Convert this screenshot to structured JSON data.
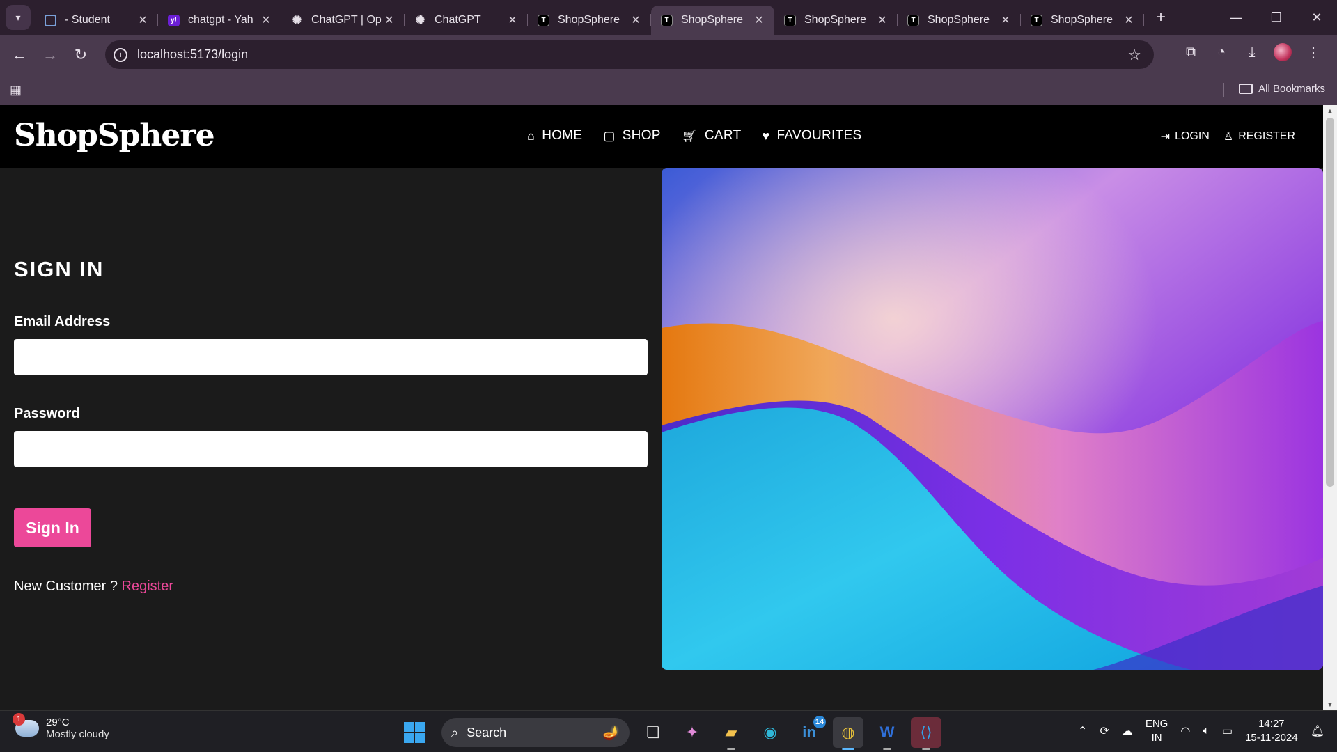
{
  "browser": {
    "tabs": [
      {
        "title": "- Student",
        "favicon": "doc-icon"
      },
      {
        "title": "chatgpt - Yah",
        "favicon": "yahoo-icon"
      },
      {
        "title": "ChatGPT | Op",
        "favicon": "openai-icon"
      },
      {
        "title": "ChatGPT",
        "favicon": "openai-icon"
      },
      {
        "title": "ShopSphere",
        "favicon": "t-icon"
      },
      {
        "title": "ShopSphere",
        "favicon": "t-icon",
        "active": true
      },
      {
        "title": "ShopSphere",
        "favicon": "t-icon"
      },
      {
        "title": "ShopSphere",
        "favicon": "t-icon"
      },
      {
        "title": "ShopSphere",
        "favicon": "t-icon"
      }
    ],
    "url": "localhost:5173/login",
    "all_bookmarks": "All Bookmarks"
  },
  "site": {
    "logo": "ShopSphere",
    "nav": [
      {
        "label": "HOME",
        "icon": "home-icon"
      },
      {
        "label": "SHOP",
        "icon": "shopping-bag-icon"
      },
      {
        "label": "CART",
        "icon": "cart-icon"
      },
      {
        "label": "FAVOURITES",
        "icon": "heart-icon"
      }
    ],
    "auth": [
      {
        "label": "LOGIN",
        "icon": "login-icon"
      },
      {
        "label": "REGISTER",
        "icon": "user-icon"
      }
    ]
  },
  "form": {
    "title": "SIGN IN",
    "email_label": "Email Address",
    "email_value": "",
    "password_label": "Password",
    "password_value": "",
    "submit_label": "Sign In",
    "new_customer_text": "New Customer ?",
    "register_link": "Register"
  },
  "taskbar": {
    "weather_temp": "29°C",
    "weather_cond": "Mostly cloudy",
    "weather_badge": "1",
    "search_label": "Search",
    "linkedin_badge": "14",
    "lang_top": "ENG",
    "lang_bottom": "IN",
    "time": "14:27",
    "date": "15-11-2024"
  },
  "colors": {
    "accent": "#ec4899",
    "header_bg": "#000000",
    "page_bg": "#1b1b1b"
  }
}
